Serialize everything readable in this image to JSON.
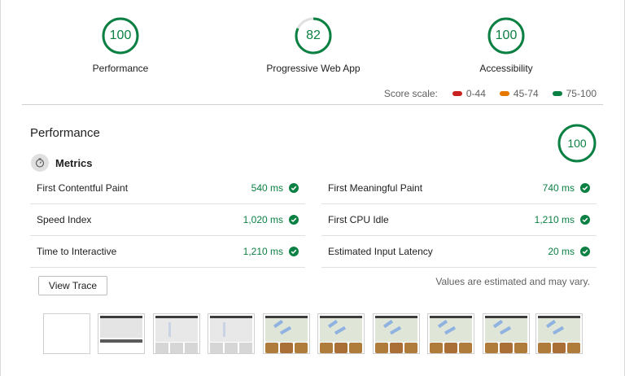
{
  "colors": {
    "pass": "#0b8043",
    "average": "#e67700",
    "fail": "#c7221f"
  },
  "gauges": [
    {
      "value": "100",
      "label": "Performance",
      "score": 1.0
    },
    {
      "value": "82",
      "label": "Progressive Web App",
      "score": 0.82
    },
    {
      "value": "100",
      "label": "Accessibility",
      "score": 1.0
    }
  ],
  "scale": {
    "title": "Score scale:",
    "ranges": [
      {
        "label": "0-44",
        "color": "#c7221f"
      },
      {
        "label": "45-74",
        "color": "#e67700"
      },
      {
        "label": "75-100",
        "color": "#0b8043"
      }
    ]
  },
  "performance": {
    "title": "Performance",
    "score": "100",
    "metrics_label": "Metrics",
    "metrics_left": [
      {
        "name": "First Contentful Paint",
        "value": "540 ms"
      },
      {
        "name": "Speed Index",
        "value": "1,020 ms"
      },
      {
        "name": "Time to Interactive",
        "value": "1,210 ms"
      }
    ],
    "metrics_right": [
      {
        "name": "First Meaningful Paint",
        "value": "740 ms"
      },
      {
        "name": "First CPU Idle",
        "value": "1,210 ms"
      },
      {
        "name": "Estimated Input Latency",
        "value": "20 ms"
      }
    ],
    "view_trace_label": "View Trace",
    "note": "Values are estimated and may vary."
  },
  "filmstrip": {
    "frames": [
      "blank",
      "header",
      "page-loading",
      "page-loading",
      "map-loaded",
      "map-loaded",
      "map-loaded",
      "map-loaded",
      "map-loaded",
      "map-loaded"
    ]
  }
}
